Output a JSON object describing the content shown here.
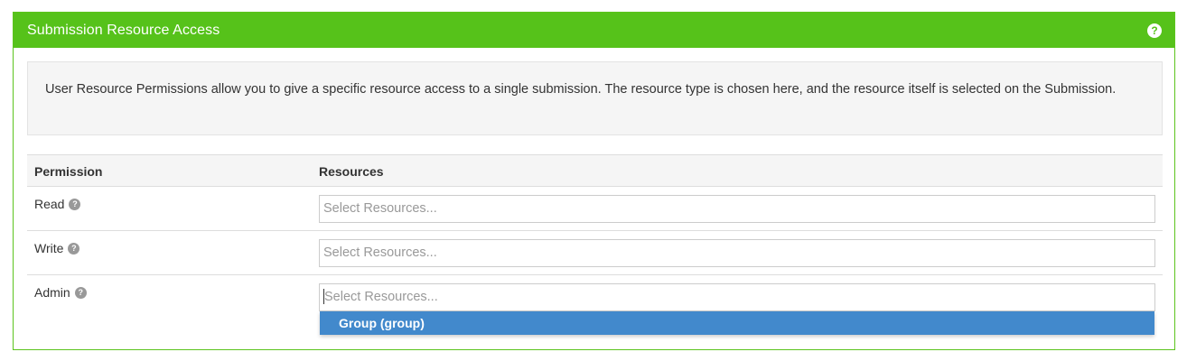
{
  "panel": {
    "title": "Submission Resource Access",
    "help_icon": "question-circle-icon",
    "description": "User Resource Permissions allow you to give a specific resource access to a single submission. The resource type is chosen here, and the resource itself is selected on the Submission."
  },
  "table": {
    "headers": [
      "Permission",
      "Resources"
    ],
    "rows": [
      {
        "label": "Read",
        "placeholder": "Select Resources..."
      },
      {
        "label": "Write",
        "placeholder": "Select Resources..."
      },
      {
        "label": "Admin",
        "placeholder": "Select Resources..."
      }
    ]
  },
  "dropdown": {
    "options": [
      "Group (group)"
    ],
    "highlighted": "Group (group)"
  },
  "colors": {
    "header_bg": "#56c21a",
    "dropdown_highlight": "#4289cc"
  }
}
